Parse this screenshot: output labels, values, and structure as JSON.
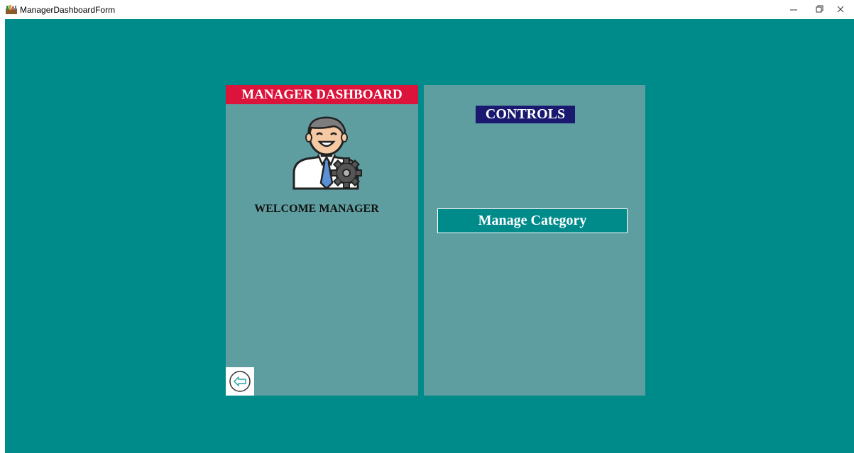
{
  "window": {
    "title": "ManagerDashboardForm",
    "icons": {
      "app": "app-icon",
      "minimize": "minimize-icon",
      "restore": "restore-icon",
      "close": "close-icon"
    }
  },
  "colors": {
    "background": "#008B8B",
    "panel": "#5F9EA0",
    "header_accent": "#DC143C",
    "controls_title": "#191970"
  },
  "left_panel": {
    "header": "MANAGER DASHBOARD",
    "welcome": "WELCOME MANAGER",
    "avatar_icon": "manager-avatar-icon",
    "back_icon": "back-arrow-icon"
  },
  "right_panel": {
    "title": "CONTROLS",
    "buttons": [
      {
        "label": "Manage Category"
      }
    ]
  }
}
